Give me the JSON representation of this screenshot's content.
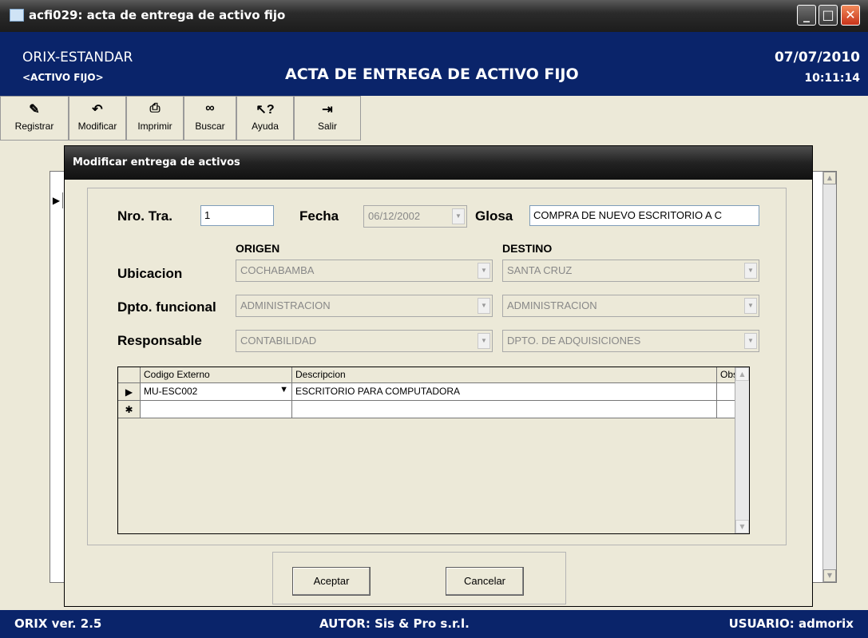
{
  "window": {
    "title": "acfi029: acta de entrega de activo fijo"
  },
  "header": {
    "company": "ORIX-ESTANDAR",
    "module": "<ACTIVO FIJO>",
    "screen_title": "ACTA DE ENTREGA DE ACTIVO FIJO",
    "date": "07/07/2010",
    "time": "10:11:14"
  },
  "toolbar": [
    {
      "label": "Registrar",
      "icon": "register-icon"
    },
    {
      "label": "Modificar",
      "icon": "undo-icon"
    },
    {
      "label": "Imprimir",
      "icon": "printer-icon"
    },
    {
      "label": "Buscar",
      "icon": "binoculars-icon"
    },
    {
      "label": "Ayuda",
      "icon": "help-icon"
    },
    {
      "label": "Salir",
      "icon": "exit-icon"
    }
  ],
  "dialog": {
    "title": "Modificar entrega de activos",
    "nro_tra_label": "Nro. Tra.",
    "nro_tra_value": "1",
    "fecha_label": "Fecha",
    "fecha_value": "06/12/2002",
    "glosa_label": "Glosa",
    "glosa_value": "COMPRA DE NUEVO ESCRITORIO A C",
    "origen_label": "ORIGEN",
    "destino_label": "DESTINO",
    "ubicacion_label": "Ubicacion",
    "dpto_label": "Dpto. funcional",
    "responsable_label": "Responsable",
    "origen": {
      "ubicacion": "COCHABAMBA",
      "dpto": "ADMINISTRACION",
      "responsable": "CONTABILIDAD"
    },
    "destino": {
      "ubicacion": "SANTA CRUZ",
      "dpto": "ADMINISTRACION",
      "responsable": "DPTO. DE ADQUISICIONES"
    },
    "grid": {
      "headers": [
        "Codigo Externo",
        "Descripcion",
        "Obs"
      ],
      "rows": [
        {
          "codigo": "MU-ESC002",
          "descripcion": "ESCRITORIO PARA COMPUTADORA",
          "obs": ""
        }
      ]
    },
    "accept_label": "Aceptar",
    "cancel_label": "Cancelar"
  },
  "status": {
    "version": "ORIX ver. 2.5",
    "author": "AUTOR: Sis & Pro s.r.l.",
    "user": "USUARIO: admorix"
  },
  "colors": {
    "header_bg": "#0a246a",
    "window_bg": "#ece9d8",
    "close_button": "#c8331a"
  }
}
